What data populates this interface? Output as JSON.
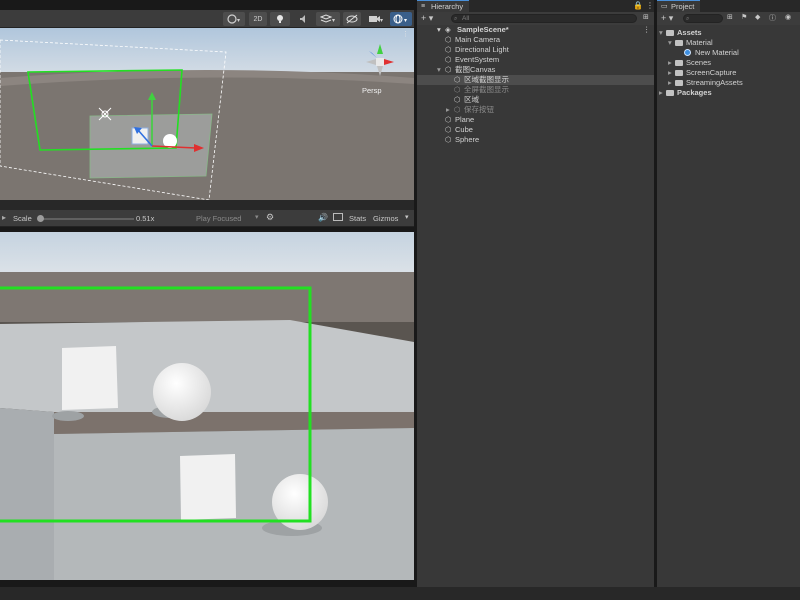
{
  "scene_toolbar": {
    "btn_2d": "2D",
    "persp_label": "Persp"
  },
  "scene_bottom": {
    "scale_label": "Scale",
    "scale_value": "0.51x",
    "play_mode": "Play Focused",
    "stats": "Stats",
    "gizmos": "Gizmos"
  },
  "hierarchy": {
    "tab_label": "Hierarchy",
    "add_label": "+ ▾",
    "search_placeholder": "All",
    "scene_name": "SampleScene*",
    "items": [
      {
        "label": "Main Camera",
        "indent": 1,
        "selected": false,
        "dim": false,
        "expander": ""
      },
      {
        "label": "Directional Light",
        "indent": 1,
        "selected": false,
        "dim": false,
        "expander": ""
      },
      {
        "label": "EventSystem",
        "indent": 1,
        "selected": false,
        "dim": false,
        "expander": ""
      },
      {
        "label": "截图Canvas",
        "indent": 1,
        "selected": false,
        "dim": false,
        "expander": "▾"
      },
      {
        "label": "区域截图显示",
        "indent": 2,
        "selected": true,
        "dim": false,
        "expander": ""
      },
      {
        "label": "全屏截图显示",
        "indent": 2,
        "selected": false,
        "dim": true,
        "expander": ""
      },
      {
        "label": "区域",
        "indent": 2,
        "selected": false,
        "dim": false,
        "expander": ""
      },
      {
        "label": "保存按钮",
        "indent": 2,
        "selected": false,
        "dim": true,
        "expander": "▸"
      },
      {
        "label": "Plane",
        "indent": 1,
        "selected": false,
        "dim": false,
        "expander": ""
      },
      {
        "label": "Cube",
        "indent": 1,
        "selected": false,
        "dim": false,
        "expander": ""
      },
      {
        "label": "Sphere",
        "indent": 1,
        "selected": false,
        "dim": false,
        "expander": ""
      }
    ]
  },
  "project": {
    "tab_label": "Project",
    "add_label": "+ ▾",
    "items": [
      {
        "label": "Assets",
        "indent": 0,
        "bold": true,
        "expander": "▾",
        "icon": "folder-open-icon"
      },
      {
        "label": "Material",
        "indent": 1,
        "bold": false,
        "expander": "▾",
        "icon": "folder-open-icon"
      },
      {
        "label": "New Material",
        "indent": 2,
        "bold": false,
        "expander": "",
        "icon": "material-sphere-icon"
      },
      {
        "label": "Scenes",
        "indent": 1,
        "bold": false,
        "expander": "▸",
        "icon": "folder-icon"
      },
      {
        "label": "ScreenCapture",
        "indent": 1,
        "bold": false,
        "expander": "▸",
        "icon": "folder-icon"
      },
      {
        "label": "StreamingAssets",
        "indent": 1,
        "bold": false,
        "expander": "▸",
        "icon": "folder-icon"
      },
      {
        "label": "Packages",
        "indent": 0,
        "bold": true,
        "expander": "▸",
        "icon": "folder-icon"
      }
    ]
  },
  "colors": {
    "selection_frame": "#22e022",
    "axis_x": "#e03030",
    "axis_y": "#40d040",
    "axis_z": "#3070e0",
    "panel_bg": "#383838",
    "toolbar_bg": "#3c3c3c"
  }
}
